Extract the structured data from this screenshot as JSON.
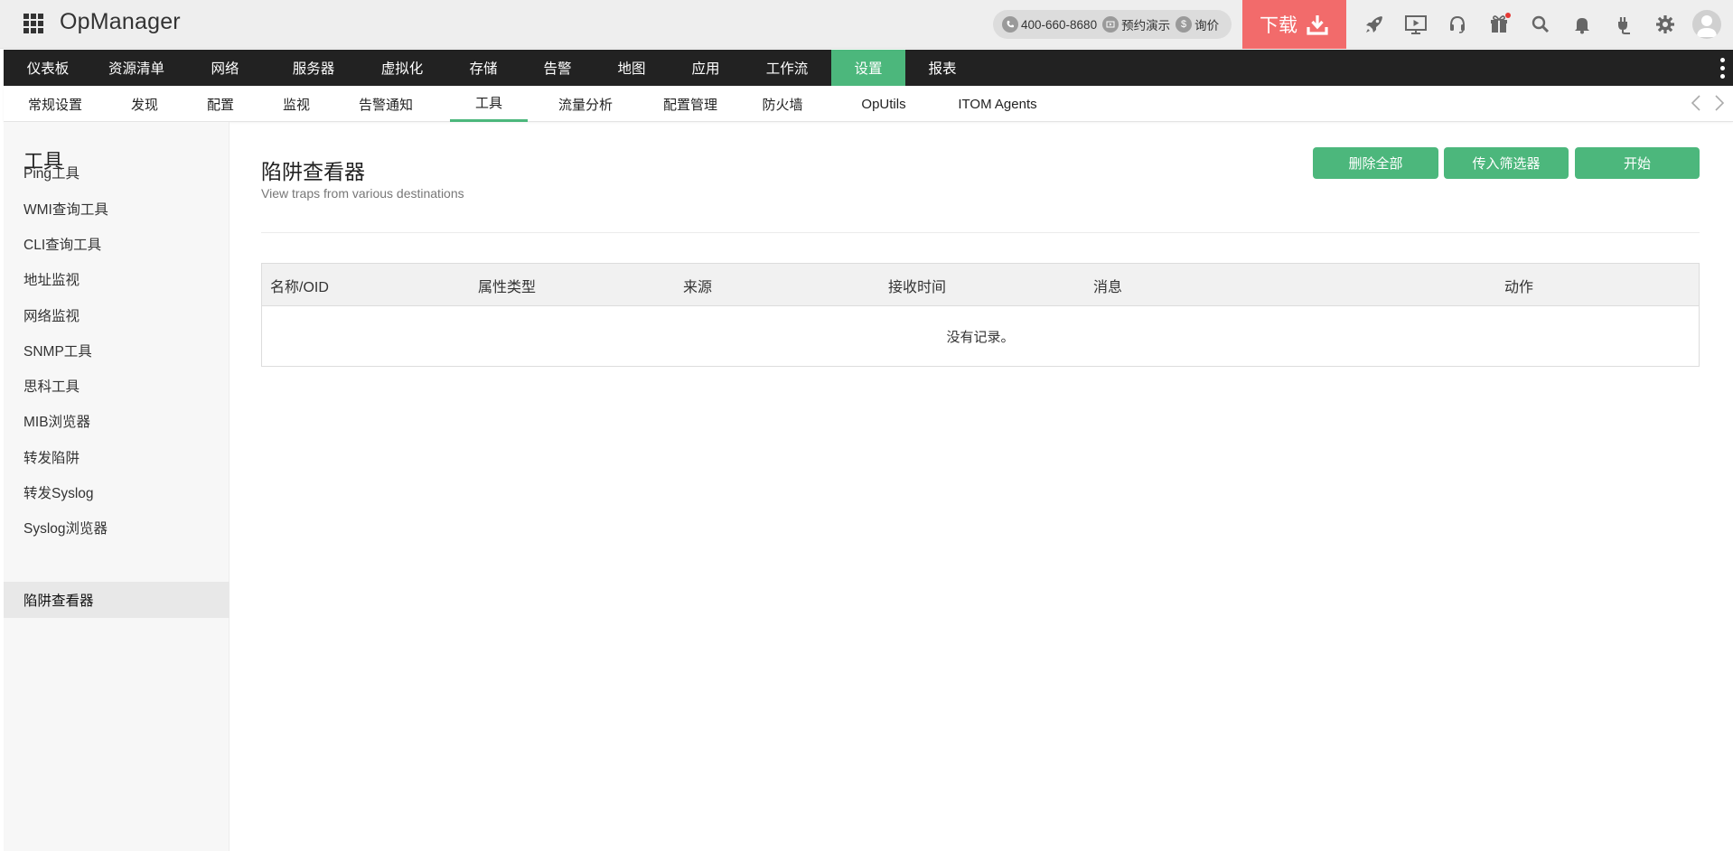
{
  "header": {
    "brand": "OpManager",
    "phone": "400-660-8680",
    "demo_label": "预约演示",
    "price_label": "询价",
    "download_label": "下载"
  },
  "main_nav": {
    "items": [
      {
        "label": "仪表板"
      },
      {
        "label": "资源清单"
      },
      {
        "label": "网络"
      },
      {
        "label": "服务器"
      },
      {
        "label": "虚拟化"
      },
      {
        "label": "存储"
      },
      {
        "label": "告警"
      },
      {
        "label": "地图"
      },
      {
        "label": "应用"
      },
      {
        "label": "工作流"
      },
      {
        "label": "设置",
        "active": true
      },
      {
        "label": "报表"
      }
    ]
  },
  "sub_nav": {
    "items": [
      {
        "label": "常规设置"
      },
      {
        "label": "发现"
      },
      {
        "label": "配置"
      },
      {
        "label": "监视"
      },
      {
        "label": "告警通知"
      },
      {
        "label": "工具",
        "active": true
      },
      {
        "label": "流量分析"
      },
      {
        "label": "配置管理"
      },
      {
        "label": "防火墙"
      },
      {
        "label": "OpUtils"
      },
      {
        "label": "ITOM Agents"
      }
    ]
  },
  "sidebar": {
    "title": "工具",
    "items": [
      {
        "label": "Ping工具"
      },
      {
        "label": "WMI查询工具"
      },
      {
        "label": "CLI查询工具"
      },
      {
        "label": "地址监视"
      },
      {
        "label": "网络监视"
      },
      {
        "label": "SNMP工具"
      },
      {
        "label": "思科工具"
      },
      {
        "label": "MIB浏览器"
      },
      {
        "label": "转发陷阱"
      },
      {
        "label": "转发Syslog"
      },
      {
        "label": "Syslog浏览器"
      },
      {
        "label": "陷阱查看器",
        "active": true
      }
    ]
  },
  "main": {
    "title": "陷阱查看器",
    "subtitle": "View traps from various destinations",
    "buttons": {
      "delete_all": "删除全部",
      "incoming_filter": "传入筛选器",
      "start": "开始"
    },
    "table": {
      "columns": [
        "名称/OID",
        "属性类型",
        "来源",
        "接收时间",
        "消息",
        "动作"
      ],
      "empty_text": "没有记录。"
    }
  },
  "colors": {
    "accent_green": "#4cb77c",
    "download_red": "#f26b6b",
    "nav_dark": "#222222"
  },
  "icons": {
    "header": [
      "rocket-icon",
      "video-demo-icon",
      "support-headset-icon",
      "gift-icon",
      "search-icon",
      "bell-icon",
      "plug-icon",
      "gear-icon"
    ]
  }
}
